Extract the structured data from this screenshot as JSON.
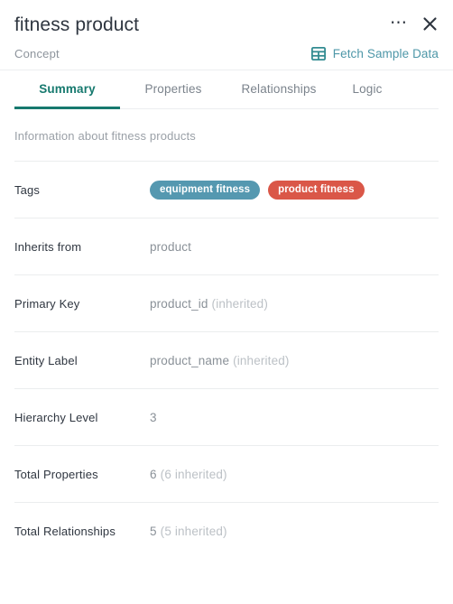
{
  "header": {
    "title": "fitness product",
    "subtitle": "Concept",
    "more_icon": "more-horizontal-icon",
    "close_icon": "close-icon",
    "fetch_label": "Fetch Sample Data",
    "fetch_icon": "table-grid-icon"
  },
  "tabs": [
    {
      "label": "Summary",
      "active": true
    },
    {
      "label": "Properties",
      "active": false
    },
    {
      "label": "Relationships",
      "active": false
    },
    {
      "label": "Logic",
      "active": false
    }
  ],
  "summary": {
    "description": "Information about fitness products",
    "tags_label": "Tags",
    "tags": [
      {
        "text": "equipment fitness",
        "color": "#5598b0"
      },
      {
        "text": "product fitness",
        "color": "#da5748"
      }
    ],
    "rows": [
      {
        "label": "Inherits from",
        "value": "product",
        "note": ""
      },
      {
        "label": "Primary Key",
        "value": "product_id",
        "note": "(inherited)"
      },
      {
        "label": "Entity Label",
        "value": "product_name",
        "note": "(inherited)"
      },
      {
        "label": "Hierarchy Level",
        "value": "3",
        "note": ""
      },
      {
        "label": "Total Properties",
        "value": "6",
        "note": "(6 inherited)"
      },
      {
        "label": "Total Relationships",
        "value": "5",
        "note": "(5 inherited)"
      }
    ]
  },
  "colors": {
    "accent_teal": "#16796e",
    "link_blue": "#4e97a8",
    "tag_blue": "#5598b0",
    "tag_red": "#da5748"
  }
}
